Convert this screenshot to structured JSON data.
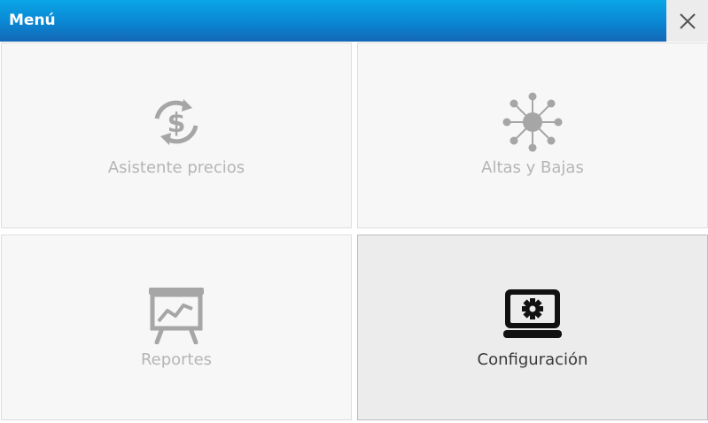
{
  "window": {
    "title": "Menú",
    "close_icon": "close-icon"
  },
  "colors": {
    "titlebar_top": "#0aa6e6",
    "titlebar_bottom": "#1467b6",
    "tile_background": "#f7f7f7",
    "tile_selected_background": "#ebeceb",
    "icon_disabled": "#a6a6a6",
    "icon_active": "#111111",
    "label_disabled": "#b5b5b5",
    "label_active": "#3a3a3a"
  },
  "menu": {
    "items": [
      {
        "label": "Asistente precios",
        "icon": "price-cycle-icon",
        "selected": false
      },
      {
        "label": "Altas y Bajas",
        "icon": "network-hub-icon",
        "selected": false
      },
      {
        "label": "Reportes",
        "icon": "presentation-board-icon",
        "selected": false
      },
      {
        "label": "Configuración",
        "icon": "laptop-gear-icon",
        "selected": true
      }
    ]
  }
}
